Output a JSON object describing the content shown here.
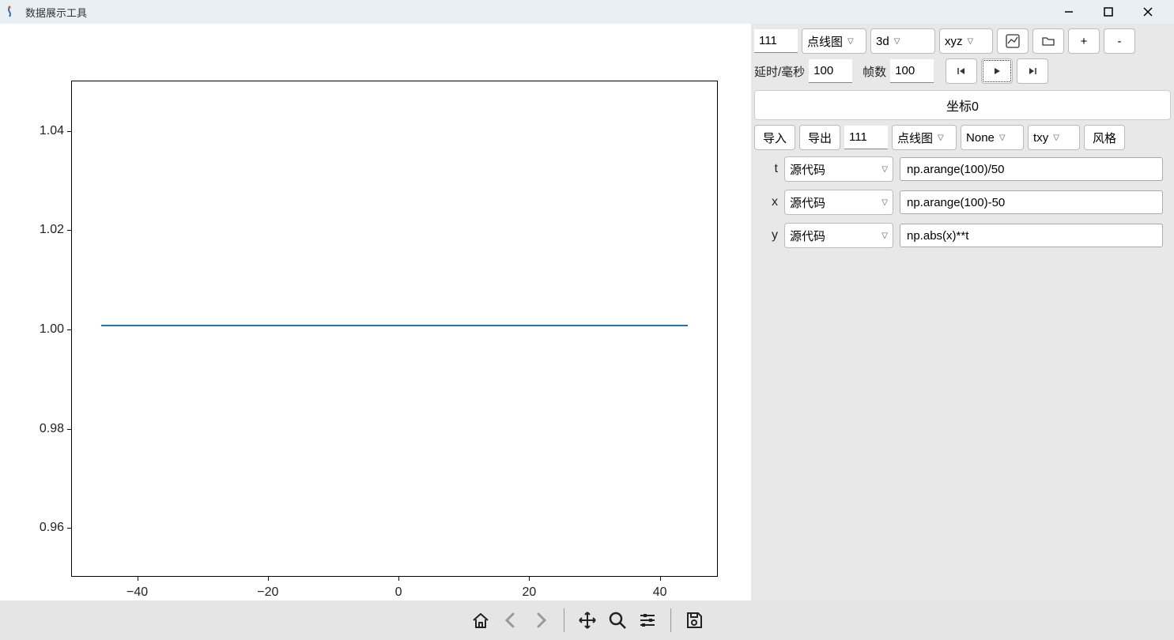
{
  "window": {
    "title": "数据展示工具",
    "minimize": "—",
    "maximize": "☐",
    "close": "✕"
  },
  "toolbar_top": {
    "subplot_id": "111",
    "plot_type": "点线图",
    "dim": "3d",
    "coord_mode": "xyz",
    "plus": "+",
    "minus": "-"
  },
  "anim": {
    "delay_label": "延时/毫秒",
    "delay_value": "100",
    "frames_label": "帧数",
    "frames_value": "100"
  },
  "coord_section": {
    "header": "坐标0",
    "import": "导入",
    "export": "导出",
    "subplot_id": "111",
    "plot_type": "点线图",
    "none_opt": "None",
    "axis_mode": "txy",
    "style": "风格"
  },
  "axes": {
    "t": {
      "label": "t",
      "source": "源代码",
      "expr": "np.arange(100)/50"
    },
    "x": {
      "label": "x",
      "source": "源代码",
      "expr": "np.arange(100)-50"
    },
    "y": {
      "label": "y",
      "source": "源代码",
      "expr": "np.abs(x)**t"
    }
  },
  "chart_data": {
    "type": "line",
    "title": "",
    "xlabel": "",
    "ylabel": "",
    "x": [
      -50,
      -49,
      -48,
      -47,
      -46,
      -45,
      -44,
      -43,
      -42,
      -41,
      -40,
      -39,
      -38,
      -37,
      -36,
      -35,
      -34,
      -33,
      -32,
      -31,
      -30,
      -29,
      -28,
      -27,
      -26,
      -25,
      -24,
      -23,
      -22,
      -21,
      -20,
      -19,
      -18,
      -17,
      -16,
      -15,
      -14,
      -13,
      -12,
      -11,
      -10,
      -9,
      -8,
      -7,
      -6,
      -5,
      -4,
      -3,
      -2,
      -1,
      0,
      1,
      2,
      3,
      4,
      5,
      6,
      7,
      8,
      9,
      10,
      11,
      12,
      13,
      14,
      15,
      16,
      17,
      18,
      19,
      20,
      21,
      22,
      23,
      24,
      25,
      26,
      27,
      28,
      29,
      30,
      31,
      32,
      33,
      34,
      35,
      36,
      37,
      38,
      39,
      40,
      41,
      42,
      43,
      44,
      45,
      46,
      47,
      48,
      49
    ],
    "y": [
      1.0,
      1.0,
      1.0,
      1.0,
      1.0,
      1.0,
      1.0,
      1.0,
      1.0,
      1.0,
      1.0,
      1.0,
      1.0,
      1.0,
      1.0,
      1.0,
      1.0,
      1.0,
      1.0,
      1.0,
      1.0,
      1.0,
      1.0,
      1.0,
      1.0,
      1.0,
      1.0,
      1.0,
      1.0,
      1.0,
      1.0,
      1.0,
      1.0,
      1.0,
      1.0,
      1.0,
      1.0,
      1.0,
      1.0,
      1.0,
      1.0,
      1.0,
      1.0,
      1.0,
      1.0,
      1.0,
      1.0,
      1.0,
      1.0,
      1.0,
      1.0,
      1.0,
      1.0,
      1.0,
      1.0,
      1.0,
      1.0,
      1.0,
      1.0,
      1.0,
      1.0,
      1.0,
      1.0,
      1.0,
      1.0,
      1.0,
      1.0,
      1.0,
      1.0,
      1.0,
      1.0,
      1.0,
      1.0,
      1.0,
      1.0,
      1.0,
      1.0,
      1.0,
      1.0,
      1.0,
      1.0,
      1.0,
      1.0,
      1.0,
      1.0,
      1.0,
      1.0,
      1.0,
      1.0,
      1.0,
      1.0,
      1.0,
      1.0,
      1.0,
      1.0,
      1.0,
      1.0,
      1.0,
      1.0,
      1.0
    ],
    "xlim": [
      -50,
      49
    ],
    "ylim": [
      0.95,
      1.05
    ],
    "xticks": [
      {
        "v": -40,
        "label": "−40"
      },
      {
        "v": -20,
        "label": "−20"
      },
      {
        "v": 0,
        "label": "0"
      },
      {
        "v": 20,
        "label": "20"
      },
      {
        "v": 40,
        "label": "40"
      }
    ],
    "yticks": [
      {
        "v": 0.96,
        "label": "0.96"
      },
      {
        "v": 0.98,
        "label": "0.98"
      },
      {
        "v": 1.0,
        "label": "1.00"
      },
      {
        "v": 1.02,
        "label": "1.02"
      },
      {
        "v": 1.04,
        "label": "1.04"
      }
    ]
  }
}
